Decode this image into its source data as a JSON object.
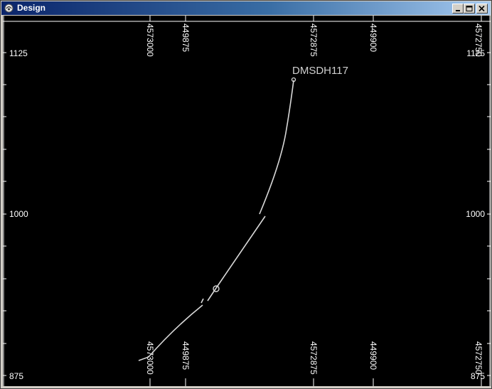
{
  "window": {
    "title": "Design",
    "icon": "app-icon",
    "controls": {
      "minimize": "minimize-icon",
      "maximize": "maximize-icon",
      "close": "close-icon"
    }
  },
  "plot": {
    "background": "#000000",
    "foreground": "#ffffff",
    "trace_color": "#d8d8d8",
    "well_name": "DMSDH117",
    "y_axis": {
      "left_labels": [
        "1125",
        "1000",
        "875"
      ],
      "right_labels": [
        "1125",
        "1000",
        "875"
      ]
    },
    "x_axis": {
      "top_labels": [
        "4573000",
        "449875",
        "4572875",
        "449900",
        "4572750"
      ],
      "bottom_labels": [
        "4573000",
        "449875",
        "4572875",
        "449900",
        "4572750"
      ]
    }
  }
}
